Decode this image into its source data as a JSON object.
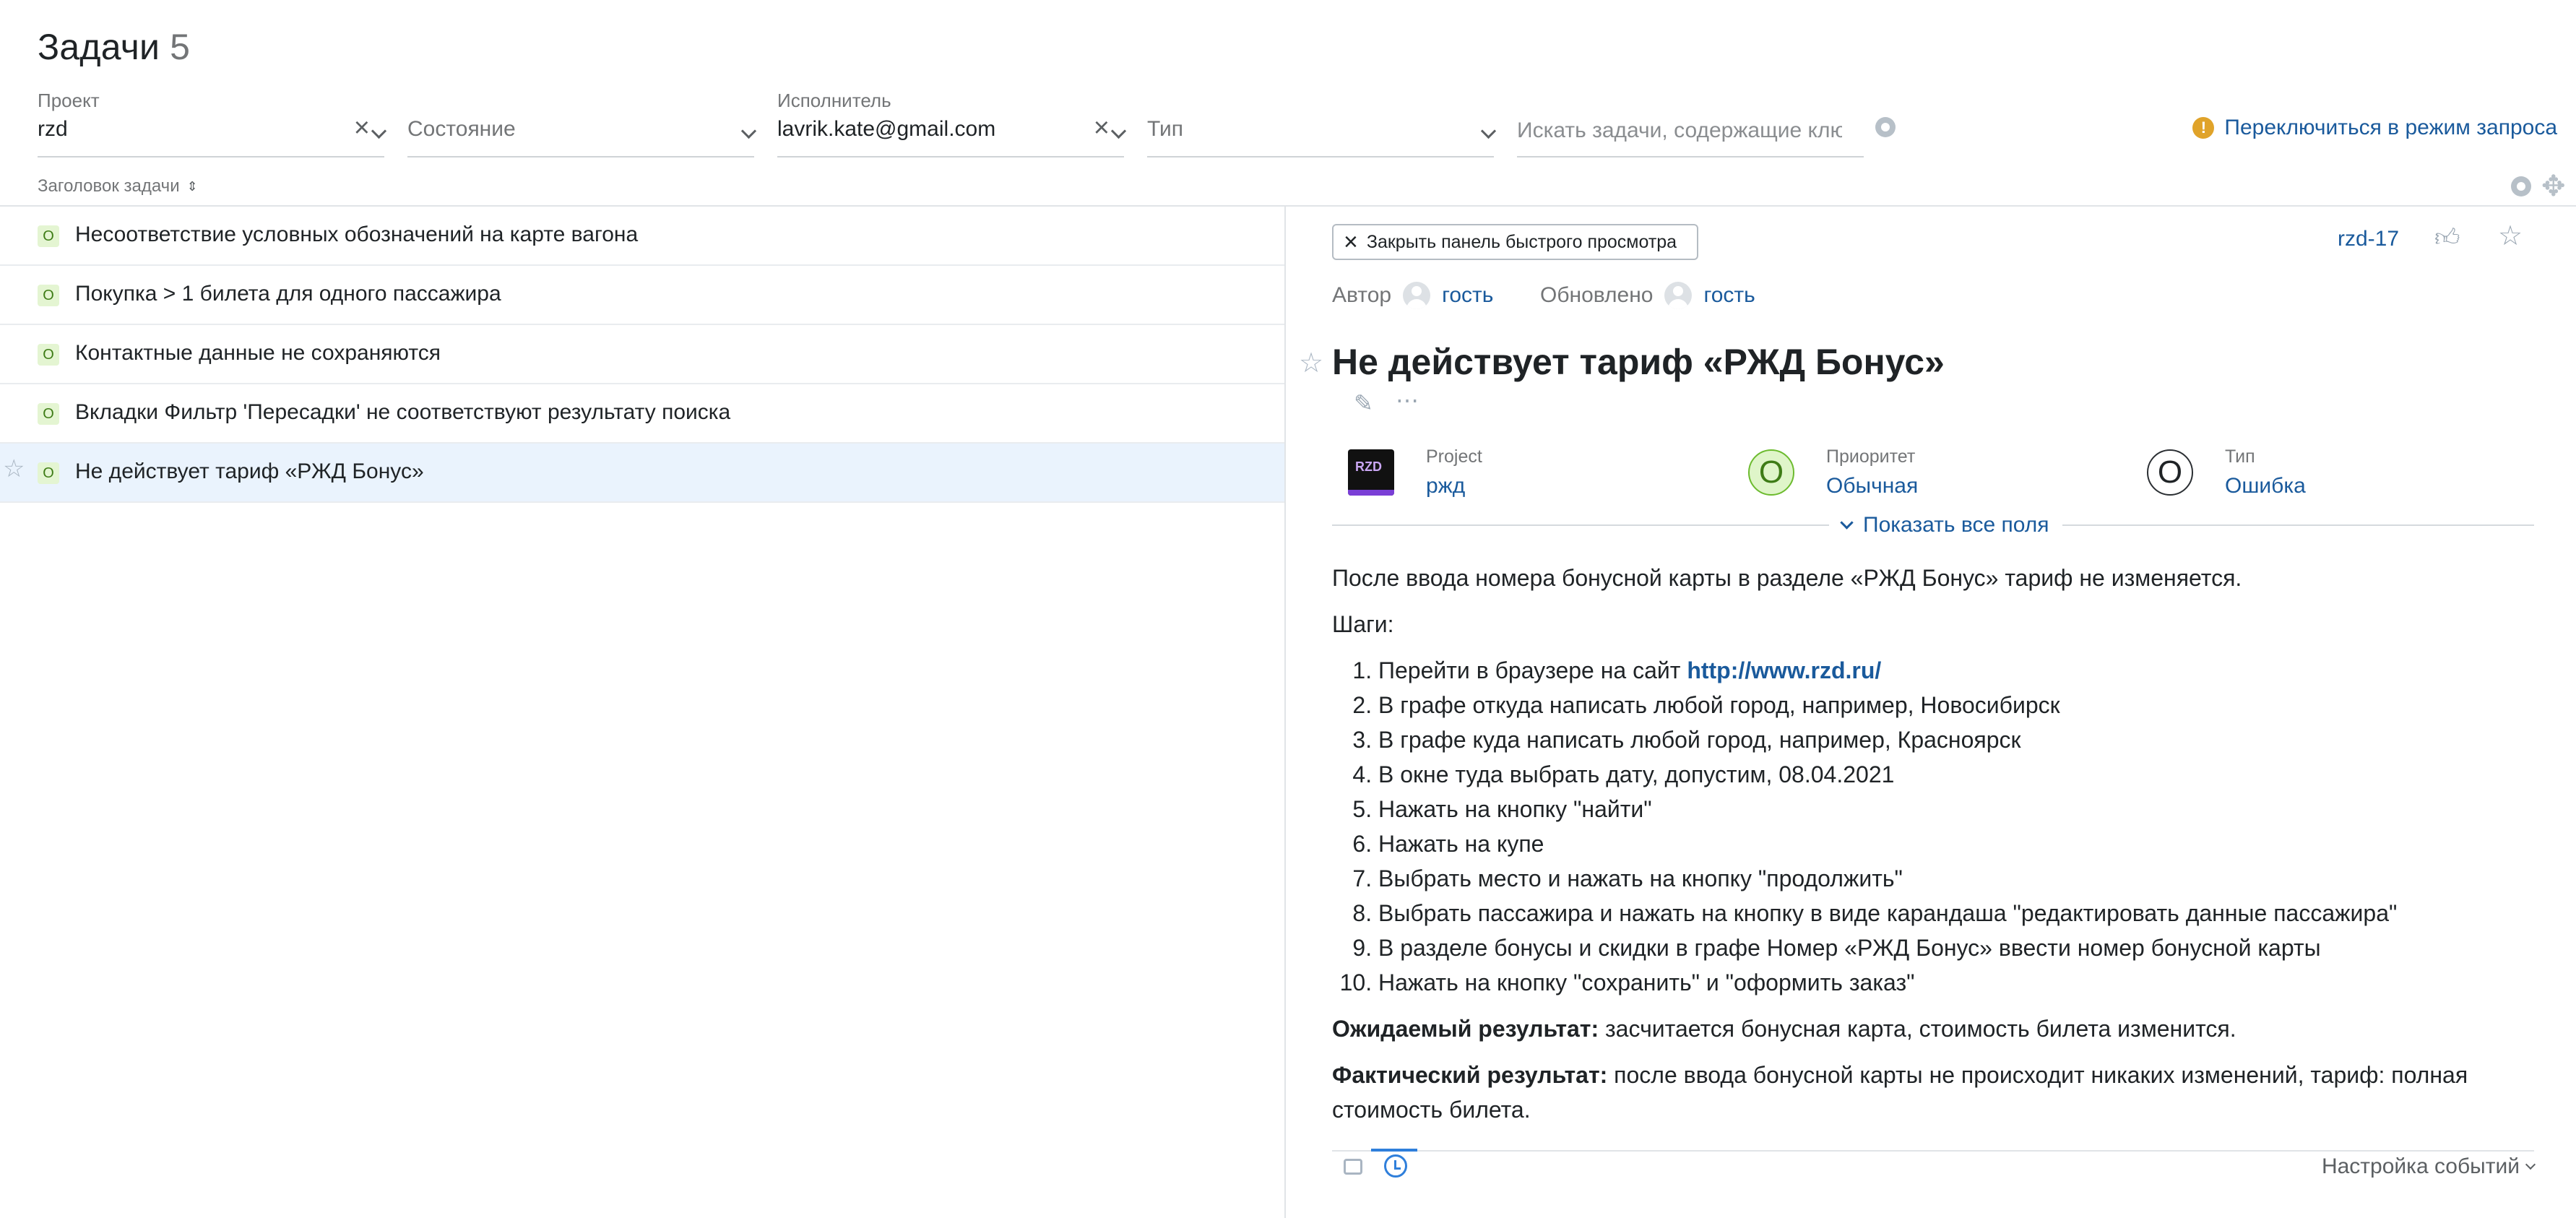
{
  "header": {
    "title": "Задачи",
    "count": "5"
  },
  "filters": {
    "project": {
      "label": "Проект",
      "value": "rzd"
    },
    "state": {
      "placeholder": "Состояние"
    },
    "assignee": {
      "label": "Исполнитель",
      "value": "lavrik.kate@gmail.com"
    },
    "type": {
      "placeholder": "Тип"
    },
    "search": {
      "placeholder": "Искать задачи, содержащие ключевые слова"
    },
    "switch_mode": "Переключиться в режим запроса"
  },
  "list": {
    "sort_label": "Заголовок задачи",
    "issues": [
      {
        "badge": "О",
        "summary": "Несоответствие условных обозначений на карте вагона"
      },
      {
        "badge": "О",
        "summary": "Покупка > 1 билета для одного пассажира"
      },
      {
        "badge": "О",
        "summary": "Контактные данные не сохраняются"
      },
      {
        "badge": "О",
        "summary": "Вкладки Фильтр 'Пересадки' не соответствуют результату поиска"
      },
      {
        "badge": "О",
        "summary": "Не действует тариф «РЖД Бонус»"
      }
    ]
  },
  "detail": {
    "close_label": "Закрыть панель быстрого просмотра",
    "issue_id": "rzd-17",
    "author_label": "Автор",
    "author": "гость",
    "updated_label": "Обновлено",
    "updater": "гость",
    "title": "Не действует тариф «РЖД Бонус»",
    "fields": {
      "project": {
        "label": "Project",
        "value": "ржд",
        "logo": "RZD"
      },
      "priority": {
        "label": "Приоритет",
        "value": "Обычная",
        "icon_letter": "О"
      },
      "type": {
        "label": "Тип",
        "value": "Ошибка",
        "icon_letter": "О"
      }
    },
    "show_all_fields": "Показать все поля",
    "description": {
      "intro": "После ввода номера бонусной карты в разделе «РЖД Бонус» тариф не изменяется.",
      "steps_label": "Шаги:",
      "step1_prefix": "Перейти в браузере на сайт ",
      "step1_link": "http://www.rzd.ru/",
      "steps": [
        "В графе откуда написать любой город, например, Новосибирск",
        "В графе куда написать любой город, например, Красноярск",
        "В окне туда выбрать дату, допустим, 08.04.2021",
        "Нажать на кнопку \"найти\"",
        "Нажать на купе",
        "Выбрать место и нажать на кнопку \"продолжить\"",
        "Выбрать пассажира и нажать на кнопку в виде карандаша \"редактировать данные пассажира\"",
        "В разделе бонусы и скидки в графе Номер «РЖД Бонус» ввести номер бонусной карты",
        "Нажать на кнопку \"сохранить\" и \"оформить заказ\""
      ],
      "expected_label": "Ожидаемый результат:",
      "expected": " засчитается бонусная карта, стоимость билета изменится.",
      "actual_label": "Фактический результат:",
      "actual": " после ввода бонусной карты не происходит никаких изменений, тариф: полная стоимость билета."
    },
    "event_settings": "Настройка событий"
  }
}
